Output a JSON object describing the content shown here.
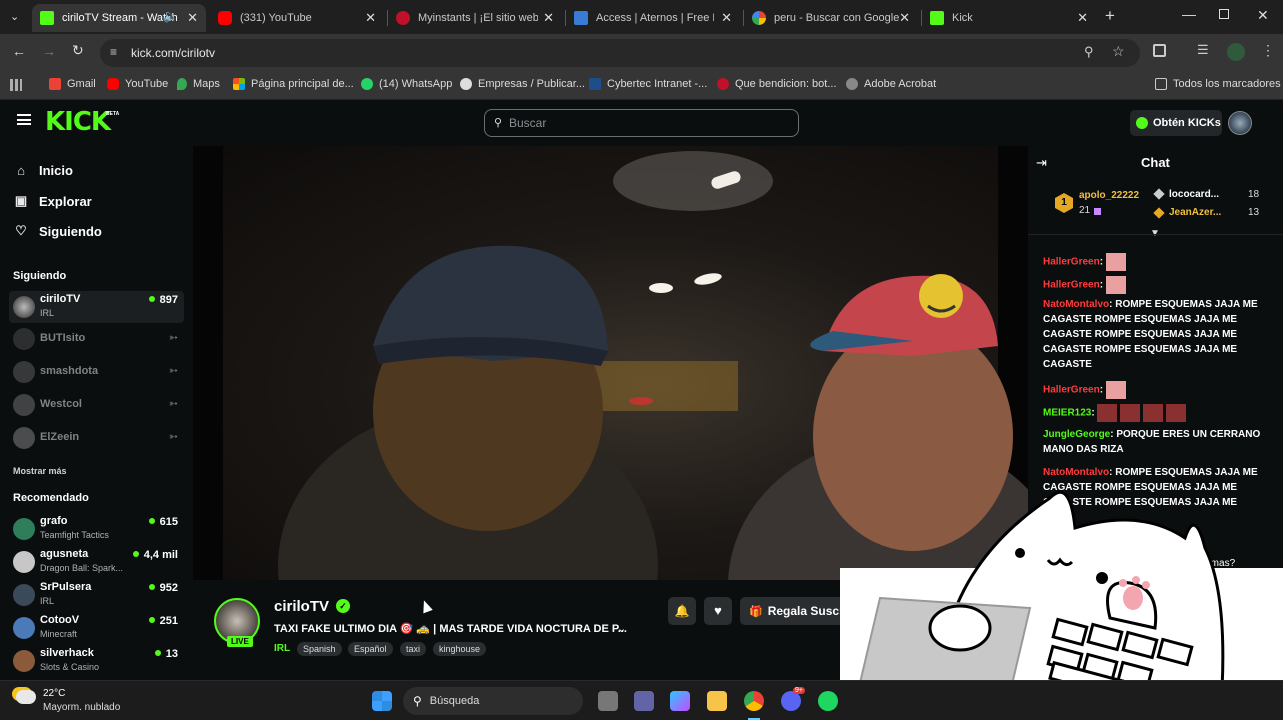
{
  "browser": {
    "tabs": [
      {
        "title": "ciriloTV Stream - Watch",
        "active": true,
        "color": "#53fc18"
      },
      {
        "title": "(331) YouTube",
        "active": false,
        "color": "#ff0000"
      },
      {
        "title": "Myinstants | ¡El sitio web d",
        "active": false,
        "color": "#c0102a"
      },
      {
        "title": "Access | Aternos | Free Min",
        "active": false,
        "color": "#3a7bd5"
      },
      {
        "title": "peru - Buscar con Google",
        "active": false,
        "color": "#4285f4"
      },
      {
        "title": "Kick",
        "active": false,
        "color": "#53fc18"
      }
    ],
    "new_tab": "+",
    "url": "kick.com/cirilotv",
    "bookmarks": [
      {
        "label": "Gmail",
        "color": "#ea4335"
      },
      {
        "label": "YouTube",
        "color": "#ff0000"
      },
      {
        "label": "Maps",
        "color": "#34a853"
      },
      {
        "label": "Página principal de...",
        "color": "#f25022"
      },
      {
        "label": "(14) WhatsApp",
        "color": "#25d366"
      },
      {
        "label": "Empresas / Publicar...",
        "color": "#cccccc"
      },
      {
        "label": "Cybertec Intranet -...",
        "color": "#1d4e89"
      },
      {
        "label": "Que bendicion: bot...",
        "color": "#c0102a"
      },
      {
        "label": "Adobe Acrobat",
        "color": "#aaaaaa"
      }
    ],
    "all_bookmarks": "Todos los marcadores"
  },
  "kick": {
    "logo": "KICK",
    "beta": "BETA",
    "search_placeholder": "Buscar",
    "get_kicks": "Obtén KICKs",
    "accent": "#53fc18"
  },
  "sidebar": {
    "nav": [
      {
        "label": "Inicio",
        "icon": "home-icon"
      },
      {
        "label": "Explorar",
        "icon": "compass-icon"
      },
      {
        "label": "Siguiendo",
        "icon": "heart-icon"
      }
    ],
    "following_title": "Siguiendo",
    "following": [
      {
        "name": "ciriloTV",
        "category": "IRL",
        "viewers": "897",
        "live": true
      },
      {
        "name": "BUTIsito",
        "category": "",
        "viewers": "",
        "live": false
      },
      {
        "name": "smashdota",
        "category": "",
        "viewers": "",
        "live": false
      },
      {
        "name": "Westcol",
        "category": "",
        "viewers": "",
        "live": false
      },
      {
        "name": "ElZeein",
        "category": "",
        "viewers": "",
        "live": false
      }
    ],
    "show_more": "Mostrar más",
    "recommended_title": "Recomendado",
    "recommended": [
      {
        "name": "grafo",
        "category": "Teamfight Tactics",
        "viewers": "615"
      },
      {
        "name": "agusneta",
        "category": "Dragon Ball: Spark...",
        "viewers": "4,4 mil"
      },
      {
        "name": "SrPulsera",
        "category": "IRL",
        "viewers": "952"
      },
      {
        "name": "CotooV",
        "category": "Minecraft",
        "viewers": "251"
      },
      {
        "name": "silverhack",
        "category": "Slots & Casino",
        "viewers": "13"
      }
    ]
  },
  "stream": {
    "channel": "ciriloTV",
    "live_badge": "LIVE",
    "title": "TAXI FAKE ULTIMO DIA 🎯 🚕 | MAS TARDE VIDA NOCTURA DE P...",
    "category": "IRL",
    "tags": [
      "Spanish",
      "Español",
      "taxi",
      "kinghouse"
    ],
    "gift_button": "Regala Suscr"
  },
  "chat": {
    "title": "Chat",
    "leaderboard": [
      {
        "name": "apolo_22222",
        "rank": "1",
        "count": "21"
      },
      {
        "name": "lococard...",
        "count": "18"
      },
      {
        "name": "JeanAzer...",
        "count": "13"
      }
    ],
    "messages": [
      {
        "user": "HallerGreen",
        "color": "#ff3b3b",
        "text": ""
      },
      {
        "user": "HallerGreen",
        "color": "#ff3b3b",
        "text": ""
      },
      {
        "user": "NatoMontalvo",
        "color": "#ff3b3b",
        "text": "ROMPE ESQUEMAS JAJA ME CAGASTE ROMPE ESQUEMAS JAJA ME CAGASTE ROMPE ESQUEMAS JAJA ME CAGASTE ROMPE ESQUEMAS JAJA ME CAGASTE"
      },
      {
        "user": "HallerGreen",
        "color": "#ff3b3b",
        "text": ""
      },
      {
        "user": "MEIER123",
        "color": "#53fc18",
        "text": ""
      },
      {
        "user": "JungleGeorge",
        "color": "#53fc18",
        "text": "PORQUE ERES UN CERRANO MANO DAS RIZA"
      },
      {
        "user": "NatoMontalvo",
        "color": "#ff3b3b",
        "text": "ROMPE ESQUEMAS JAJA ME CAGASTE ROMPE ESQUEMAS JAJA ME CAGASTE ROMPE ESQUEMAS JAJA ME"
      }
    ],
    "partial_text": "quemas?"
  },
  "taskbar": {
    "temperature": "22°C",
    "weather": "Mayorm. nublado",
    "search": "Búsqueda",
    "discord_badge": "9+"
  }
}
